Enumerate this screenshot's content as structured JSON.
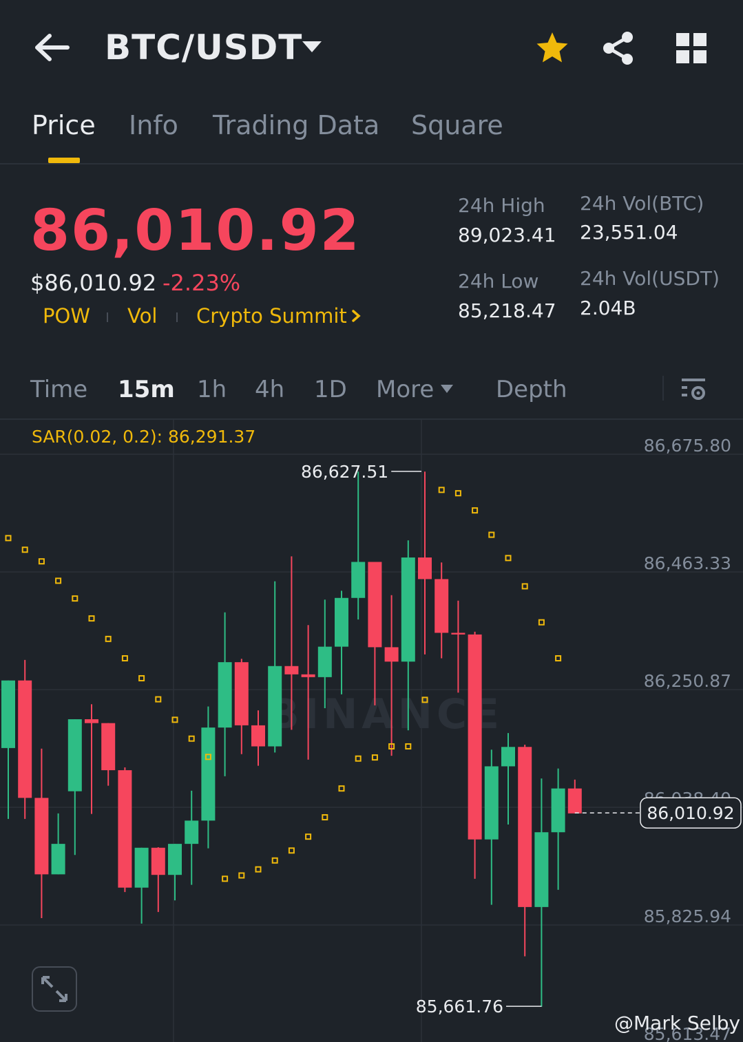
{
  "header": {
    "pair": "BTC/USDT",
    "icons": [
      "back-arrow-icon",
      "dropdown-caret-icon",
      "star-icon",
      "share-icon",
      "grid-icon"
    ],
    "favorite_color": "#f0b90b"
  },
  "tabs": [
    {
      "label": "Price",
      "active": true
    },
    {
      "label": "Info",
      "active": false
    },
    {
      "label": "Trading Data",
      "active": false
    },
    {
      "label": "Square",
      "active": false
    }
  ],
  "price": {
    "last": "86,010.92",
    "usd": "$86,010.92",
    "change": "-2.23%",
    "tags": [
      "POW",
      "Vol",
      "Crypto Summit"
    ]
  },
  "stats": {
    "high_label": "24h High",
    "high": "89,023.41",
    "low_label": "24h Low",
    "low": "85,218.47",
    "vol_btc_label": "24h Vol(BTC)",
    "vol_btc": "23,551.04",
    "vol_usdt_label": "24h Vol(USDT)",
    "vol_usdt": "2.04B"
  },
  "timebar": {
    "items": [
      "Time",
      "15m",
      "1h",
      "4h",
      "1D",
      "More",
      "Depth"
    ],
    "active": "15m"
  },
  "colors": {
    "up": "#2ebd85",
    "down": "#f6465d",
    "accent": "#f0b90b",
    "bg": "#1e2329",
    "muted": "#848e9c"
  },
  "chart_data": {
    "type": "candlestick",
    "indicator": "SAR(0.02, 0.2): 86,291.37",
    "y_axis_labels": [
      "86,675.80",
      "86,463.33",
      "86,250.87",
      "86,038.40",
      "85,825.94",
      "85,613.47"
    ],
    "ylim": [
      85613.47,
      86675.8
    ],
    "current_price": 86010.92,
    "current_price_label": "86,010.92",
    "high_marker": "86,627.51",
    "low_marker": "85,661.76",
    "watermark": "BINANCE",
    "candles": [
      {
        "o": 86128,
        "h": 86232,
        "l": 86000,
        "c": 86250
      },
      {
        "o": 86250,
        "h": 86287,
        "l": 86000,
        "c": 86038
      },
      {
        "o": 86038,
        "h": 86127,
        "l": 85821,
        "c": 85900
      },
      {
        "o": 85900,
        "h": 86010,
        "l": 85900,
        "c": 85955
      },
      {
        "o": 86050,
        "h": 85999,
        "l": 85935,
        "c": 86180
      },
      {
        "o": 86180,
        "h": 86207,
        "l": 86009,
        "c": 86173
      },
      {
        "o": 86173,
        "h": 86157,
        "l": 86060,
        "c": 86088
      },
      {
        "o": 86088,
        "h": 86093,
        "l": 85868,
        "c": 85876
      },
      {
        "o": 85876,
        "h": 85934,
        "l": 85811,
        "c": 85948
      },
      {
        "o": 85948,
        "h": 85949,
        "l": 85832,
        "c": 85899
      },
      {
        "o": 85899,
        "h": 85922,
        "l": 85853,
        "c": 85955
      },
      {
        "o": 85955,
        "h": 86051,
        "l": 85881,
        "c": 85997
      },
      {
        "o": 85997,
        "h": 86203,
        "l": 85947,
        "c": 86165
      },
      {
        "o": 86165,
        "h": 86373,
        "l": 86077,
        "c": 86283
      },
      {
        "o": 86283,
        "h": 86289,
        "l": 86117,
        "c": 86169
      },
      {
        "o": 86169,
        "h": 86196,
        "l": 86096,
        "c": 86131
      },
      {
        "o": 86131,
        "h": 86429,
        "l": 86120,
        "c": 86276
      },
      {
        "o": 86276,
        "h": 86474,
        "l": 86161,
        "c": 86261
      },
      {
        "o": 86261,
        "h": 86350,
        "l": 86107,
        "c": 86256
      },
      {
        "o": 86256,
        "h": 86396,
        "l": 86200,
        "c": 86311
      },
      {
        "o": 86311,
        "h": 86412,
        "l": 86225,
        "c": 86399
      },
      {
        "o": 86399,
        "h": 86627,
        "l": 86360,
        "c": 86464
      },
      {
        "o": 86464,
        "h": 86464,
        "l": 86205,
        "c": 86310
      },
      {
        "o": 86310,
        "h": 86404,
        "l": 86114,
        "c": 86284
      },
      {
        "o": 86284,
        "h": 86503,
        "l": 86160,
        "c": 86472
      },
      {
        "o": 86472,
        "h": 86627,
        "l": 86297,
        "c": 86433
      },
      {
        "o": 86433,
        "h": 86463,
        "l": 86290,
        "c": 86336
      },
      {
        "o": 86336,
        "h": 86394,
        "l": 86228,
        "c": 86333
      },
      {
        "o": 86333,
        "h": 86338,
        "l": 85892,
        "c": 85963
      },
      {
        "o": 85963,
        "h": 86125,
        "l": 85845,
        "c": 86095
      },
      {
        "o": 86095,
        "h": 86155,
        "l": 85990,
        "c": 86130
      },
      {
        "o": 86130,
        "h": 86134,
        "l": 85752,
        "c": 85841
      },
      {
        "o": 85841,
        "h": 86073,
        "l": 85661,
        "c": 85976
      },
      {
        "o": 85976,
        "h": 86091,
        "l": 85872,
        "c": 86055
      },
      {
        "o": 86055,
        "h": 86071,
        "l": 86048,
        "c": 86010
      }
    ],
    "sar_points": [
      86507,
      86486,
      86465,
      86430,
      86398,
      86362,
      86325,
      86290,
      86254,
      86216,
      86179,
      86145,
      86112,
      85892,
      85898,
      85909,
      85925,
      85943,
      85968,
      86003,
      86055,
      86109,
      86111,
      86131,
      86131,
      86215,
      86594,
      86588,
      86557,
      86513,
      86471,
      86420,
      86355,
      86290
    ]
  },
  "watermark_author": "@Mark Selby"
}
